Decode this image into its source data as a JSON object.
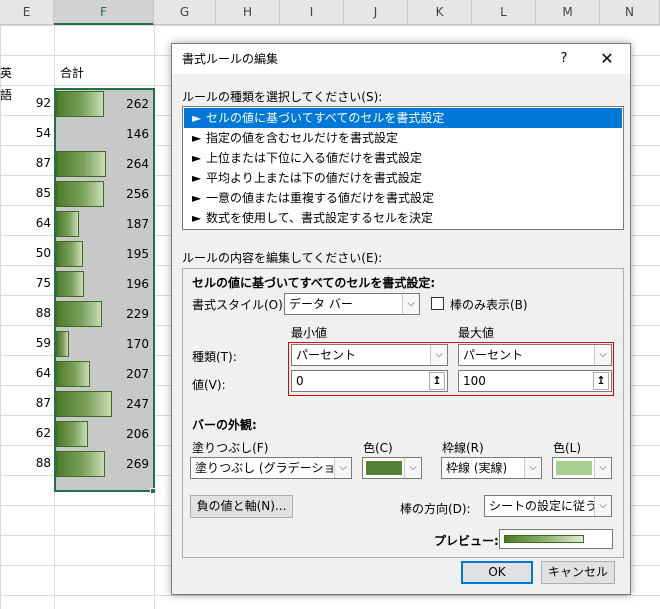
{
  "sheet": {
    "columns": [
      "E",
      "F",
      "G",
      "H",
      "I",
      "J",
      "K",
      "L",
      "M",
      "N"
    ],
    "header_e": "英語",
    "header_f": "合計",
    "rows": [
      {
        "e": "92",
        "f": "262",
        "fill": 0.69
      },
      {
        "e": "54",
        "f": "146",
        "fill": 0.0
      },
      {
        "e": "87",
        "f": "264",
        "fill": 0.71
      },
      {
        "e": "85",
        "f": "256",
        "fill": 0.68
      },
      {
        "e": "64",
        "f": "187",
        "fill": 0.33
      },
      {
        "e": "50",
        "f": "195",
        "fill": 0.38
      },
      {
        "e": "75",
        "f": "196",
        "fill": 0.4
      },
      {
        "e": "88",
        "f": "229",
        "fill": 0.66
      },
      {
        "e": "59",
        "f": "170",
        "fill": 0.19
      },
      {
        "e": "64",
        "f": "207",
        "fill": 0.48
      },
      {
        "e": "87",
        "f": "247",
        "fill": 0.8
      },
      {
        "e": "62",
        "f": "206",
        "fill": 0.45
      },
      {
        "e": "88",
        "f": "269",
        "fill": 0.7
      }
    ]
  },
  "dialog": {
    "title": "書式ルールの編集",
    "help": "?",
    "close": "✕",
    "rule_type_label": "ルールの種類を選択してください(S):",
    "rule_types": [
      "セルの値に基づいてすべてのセルを書式設定",
      "指定の値を含むセルだけを書式設定",
      "上位または下位に入る値だけを書式設定",
      "平均より上または下の値だけを書式設定",
      "一意の値または重複する値だけを書式設定",
      "数式を使用して、書式設定するセルを決定"
    ],
    "rule_type_arrow": "►",
    "edit_label": "ルールの内容を編集してください(E):",
    "section_title": "セルの値に基づいてすべてのセルを書式設定:",
    "format_style_label": "書式スタイル(O):",
    "format_style_value": "データ バー",
    "bar_only_label": "棒のみ表示(B)",
    "min_header": "最小値",
    "max_header": "最大値",
    "type_label": "種類(T):",
    "value_label": "値(V):",
    "min_type": "パーセント",
    "max_type": "パーセント",
    "min_value": "0",
    "max_value": "100",
    "picker_glyph": "↥",
    "bar_appearance_label": "バーの外観:",
    "fill_label": "塗りつぶし(F)",
    "fill_value": "塗りつぶし (グラデーション)",
    "fill_color_label": "色(C)",
    "border_label": "枠線(R)",
    "border_value": "枠線 (実線)",
    "border_color_label": "色(L)",
    "neg_axis_button": "負の値と軸(N)...",
    "direction_label": "棒の方向(D):",
    "direction_value": "シートの設定に従う",
    "preview_label": "プレビュー:",
    "ok": "OK",
    "cancel": "キャンセル",
    "dropdown_glyph": "⌵"
  },
  "colors": {
    "fill_color": "#548235",
    "border_color": "#a9d08e",
    "selection_accent": "#217346",
    "highlight_red": "#e00000",
    "list_selected": "#0078d7"
  }
}
